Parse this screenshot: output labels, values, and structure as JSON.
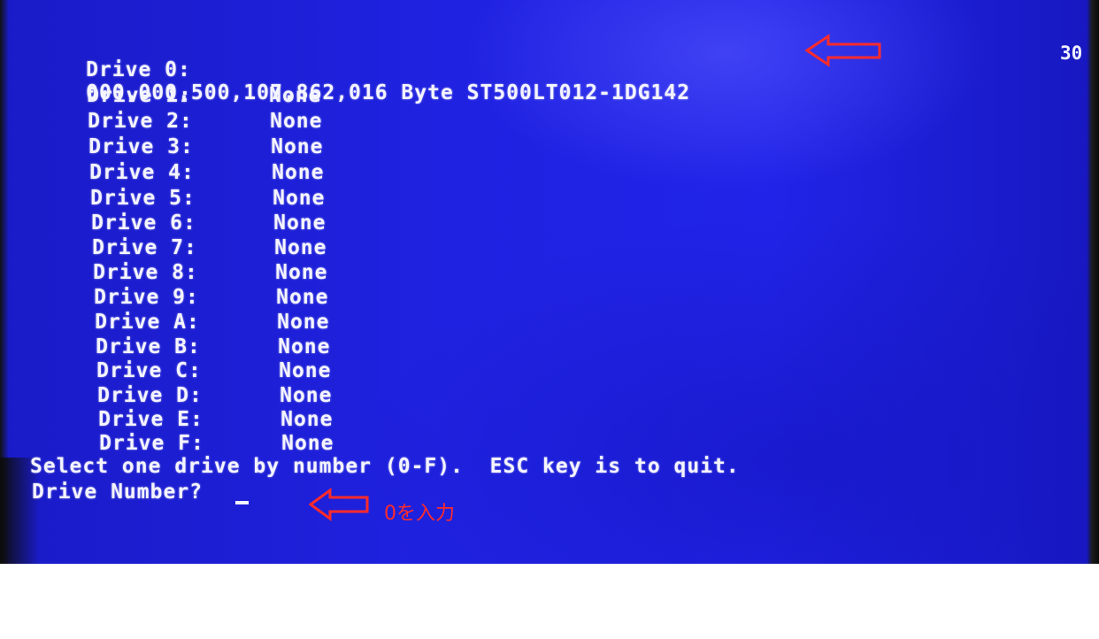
{
  "drive0": {
    "label": "Drive 0:",
    "value": "000,000,500,107,862,016 Byte ST500LT012-1DG142"
  },
  "drives": [
    {
      "label": "Drive 1:",
      "value": "None"
    },
    {
      "label": "Drive 2:",
      "value": "None"
    },
    {
      "label": "Drive 3:",
      "value": "None"
    },
    {
      "label": "Drive 4:",
      "value": "None"
    },
    {
      "label": "Drive 5:",
      "value": "None"
    },
    {
      "label": "Drive 6:",
      "value": "None"
    },
    {
      "label": "Drive 7:",
      "value": "None"
    },
    {
      "label": "Drive 8:",
      "value": "None"
    },
    {
      "label": "Drive 9:",
      "value": "None"
    },
    {
      "label": "Drive A:",
      "value": "None"
    },
    {
      "label": "Drive B:",
      "value": "None"
    },
    {
      "label": "Drive C:",
      "value": "None"
    },
    {
      "label": "Drive D:",
      "value": "None"
    },
    {
      "label": "Drive E:",
      "value": "None"
    },
    {
      "label": "Drive F:",
      "value": "None"
    }
  ],
  "counter": "30",
  "instruction": "Select one drive by number (0-F).  ESC key is to quit.",
  "prompt": "Drive Number?",
  "annotation": {
    "text": "0を入力",
    "color": "#ff2b2b"
  },
  "icons": {
    "top_arrow": "left-arrow-icon",
    "bottom_arrow": "left-arrow-icon"
  },
  "colors": {
    "screen_blue": "#2124e8",
    "text": "#f4f4ff"
  }
}
